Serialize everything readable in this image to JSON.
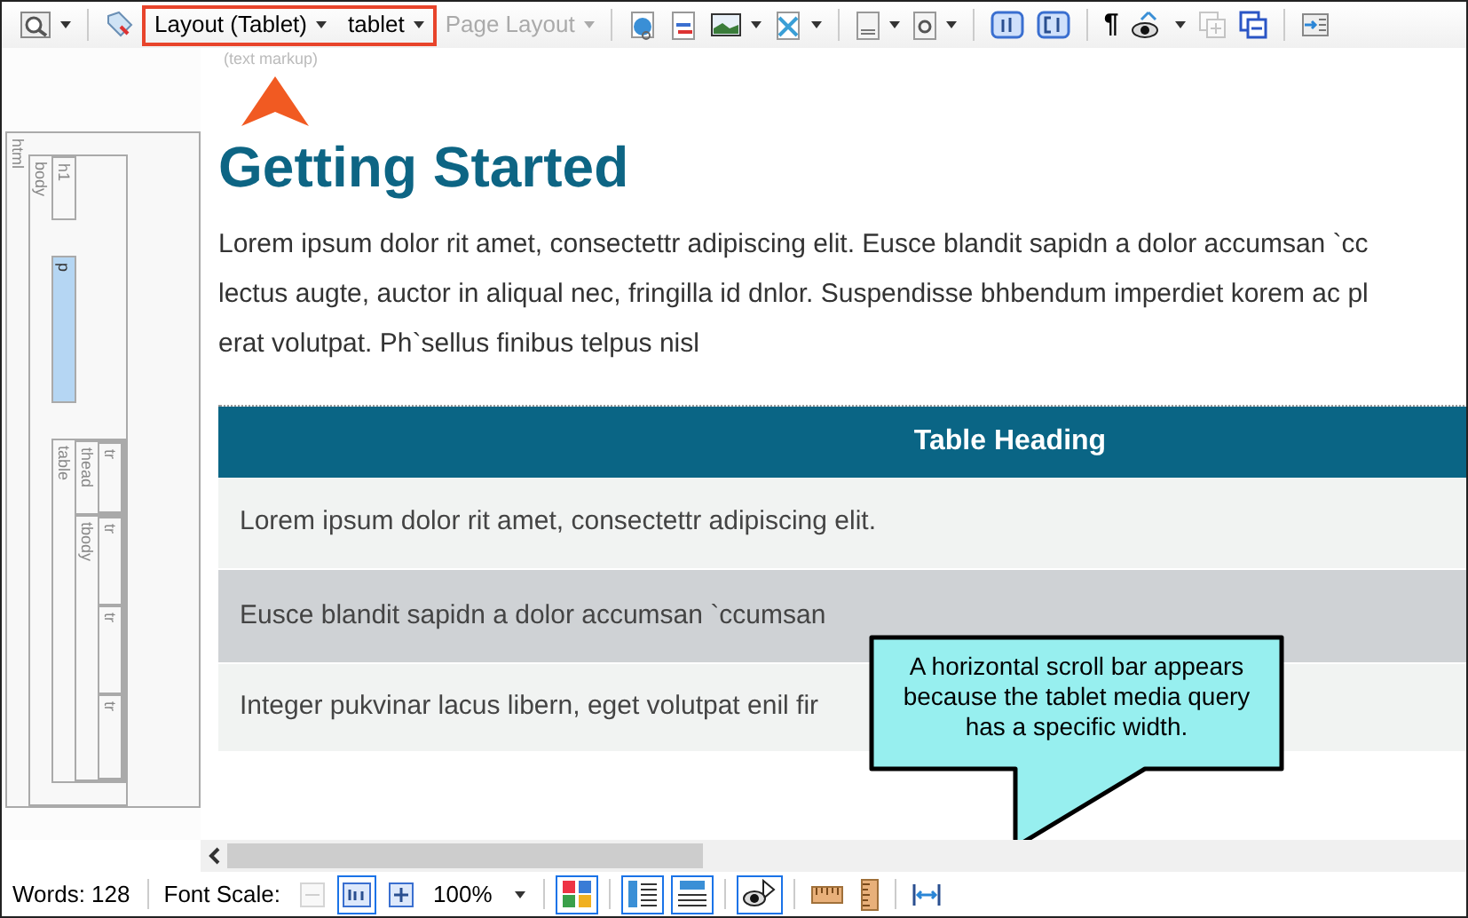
{
  "toolbar": [
    {
      "kind": "button",
      "menu": true,
      "disabled": false
    },
    {
      "kind": "separator"
    },
    {
      "kind": "button",
      "menu": false,
      "disabled": false
    },
    {
      "kind": "dropdown",
      "label": "Layout (Tablet)",
      "highlighted": true,
      "disabled": false
    },
    {
      "kind": "dropdown",
      "label": "tablet",
      "highlighted": true,
      "disabled": false
    },
    {
      "kind": "dropdown",
      "label": "Page Layout",
      "highlighted": false,
      "disabled": true
    },
    {
      "kind": "separator"
    },
    {
      "kind": "button",
      "menu": false,
      "disabled": false
    },
    {
      "kind": "button",
      "menu": false,
      "disabled": false
    },
    {
      "kind": "button",
      "menu": true,
      "disabled": false
    },
    {
      "kind": "button",
      "menu": true,
      "disabled": false
    },
    {
      "kind": "separator"
    },
    {
      "kind": "button",
      "menu": true,
      "disabled": false
    },
    {
      "kind": "button",
      "menu": true,
      "disabled": false
    },
    {
      "kind": "separator"
    },
    {
      "kind": "button",
      "menu": false,
      "disabled": false
    },
    {
      "kind": "button",
      "menu": false,
      "disabled": false
    },
    {
      "kind": "separator"
    },
    {
      "kind": "glyph",
      "label": "¶",
      "disabled": false
    },
    {
      "kind": "button",
      "menu": true,
      "disabled": false
    },
    {
      "kind": "button",
      "menu": false,
      "disabled": true
    },
    {
      "kind": "button",
      "menu": false,
      "disabled": false
    },
    {
      "kind": "separator"
    },
    {
      "kind": "button",
      "menu": false,
      "disabled": false
    }
  ],
  "markup_label": "(text markup)",
  "structure": [
    {
      "tag": "html",
      "selected": false,
      "children": [
        {
          "tag": "body",
          "selected": false,
          "children": [
            {
              "tag": "h1",
              "selected": false
            },
            {
              "tag": "p",
              "selected": true
            },
            {
              "tag": "table",
              "selected": false,
              "children": [
                {
                  "tag": "thead",
                  "selected": false,
                  "children": [
                    {
                      "tag": "tr",
                      "selected": false
                    }
                  ]
                },
                {
                  "tag": "tbody",
                  "selected": false,
                  "children": [
                    {
                      "tag": "tr",
                      "selected": false
                    },
                    {
                      "tag": "tr",
                      "selected": false
                    },
                    {
                      "tag": "tr",
                      "selected": false
                    }
                  ]
                }
              ]
            }
          ]
        }
      ]
    }
  ],
  "document": {
    "heading": "Getting Started",
    "paragraph_lines": [
      "Lorem ipsum dolor rit amet, consectettr adipiscing elit. Eusce blandit sapidn a dolor accumsan `cc",
      "lectus augte, auctor in aliqual nec, fringilla id dnlor. Suspendisse bhbendum imperdiet korem ac pl",
      "erat volutpat. Ph`sellus finibus telpus nisl"
    ],
    "table": {
      "heading": "Table Heading",
      "rows": [
        "Lorem ipsum dolor rit amet, consectettr adipiscing elit.",
        "Eusce blandit sapidn a dolor accumsan `ccumsan",
        "Integer pukvinar lacus libern, eget volutpat enil fir"
      ]
    }
  },
  "callout": "A horizontal scroll bar appears because the tablet media query has a specific width.",
  "status_bar": [
    {
      "kind": "text",
      "text": "Words: 128"
    },
    {
      "kind": "separator"
    },
    {
      "kind": "text",
      "text": "Font Scale:"
    },
    {
      "kind": "button",
      "pressed": false,
      "disabled": true
    },
    {
      "kind": "button",
      "pressed": true,
      "disabled": false
    },
    {
      "kind": "button",
      "pressed": false,
      "disabled": false
    },
    {
      "kind": "combo",
      "value": "100%"
    },
    {
      "kind": "separator"
    },
    {
      "kind": "button",
      "pressed": true,
      "disabled": false
    },
    {
      "kind": "separator"
    },
    {
      "kind": "button",
      "pressed": true,
      "disabled": false
    },
    {
      "kind": "button",
      "pressed": true,
      "disabled": false
    },
    {
      "kind": "separator"
    },
    {
      "kind": "button",
      "pressed": true,
      "disabled": false
    },
    {
      "kind": "separator"
    },
    {
      "kind": "button",
      "pressed": false,
      "disabled": false
    },
    {
      "kind": "button",
      "pressed": false,
      "disabled": false
    },
    {
      "kind": "separator"
    },
    {
      "kind": "button",
      "pressed": false,
      "disabled": false
    }
  ]
}
